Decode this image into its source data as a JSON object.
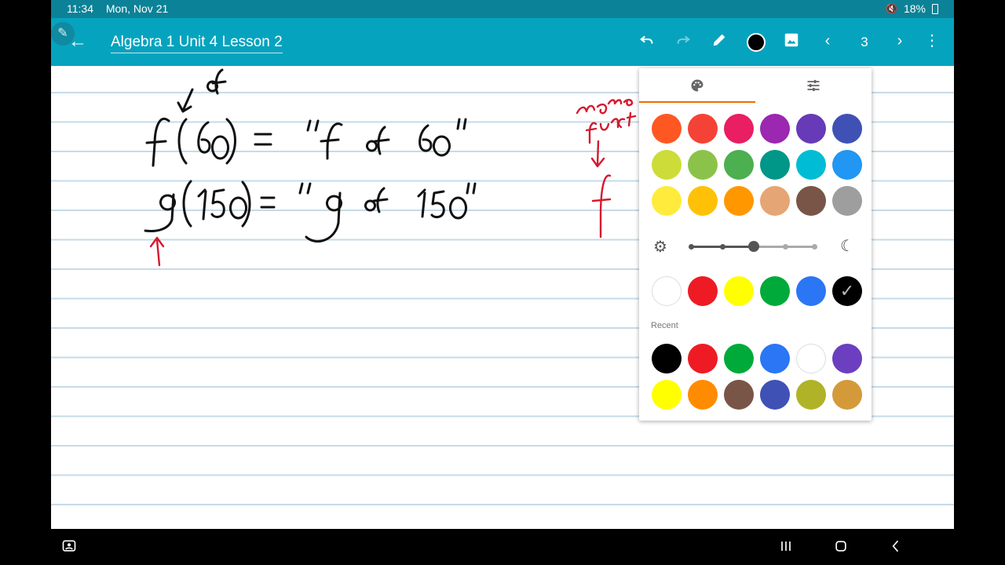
{
  "status_bar": {
    "time": "11:34",
    "date": "Mon, Nov 21",
    "battery": "18%"
  },
  "app_bar": {
    "title": "Algebra 1 Unit 4 Lesson 2",
    "page_number": "3",
    "current_color": "#000000",
    "icons": [
      "back-arrow-icon",
      "undo-icon",
      "redo-icon",
      "pen-icon",
      "image-icon",
      "chevron-left-icon",
      "chevron-right-icon",
      "more-vert-icon"
    ]
  },
  "color_panel": {
    "tabs": [
      {
        "name": "palette",
        "icon": "palette-icon",
        "active": true
      },
      {
        "name": "adjust",
        "icon": "sliders-icon",
        "active": false
      }
    ],
    "palette": [
      [
        "#ff5722",
        "#f44336",
        "#e91e63",
        "#9c27b0",
        "#673ab7",
        "#3f51b5"
      ],
      [
        "#cddc39",
        "#8bc34a",
        "#4caf50",
        "#009688",
        "#00bcd4",
        "#2196f3"
      ],
      [
        "#ffeb3b",
        "#ffc107",
        "#ff9800",
        "#e6a574",
        "#795548",
        "#9e9e9e"
      ]
    ],
    "brightness_slider": {
      "value": 0.5
    },
    "basic_colors": [
      "#ffffff",
      "#ee1b24",
      "#ffff00",
      "#00aa3a",
      "#2a76f5",
      "#000000"
    ],
    "selected_basic": 5,
    "recent_label": "Recent",
    "recent": [
      [
        "#000000",
        "#ee1b24",
        "#00aa3a",
        "#2a76f5",
        "#ffffff",
        "#6b3fbf"
      ],
      [
        "#ffff00",
        "#ff8c00",
        "#795548",
        "#3f51b5",
        "#b0b327",
        "#d49a3a"
      ]
    ]
  },
  "nav_bar": {
    "icons": [
      "screen-capture-icon",
      "recents-icon",
      "home-icon",
      "back-icon"
    ]
  }
}
